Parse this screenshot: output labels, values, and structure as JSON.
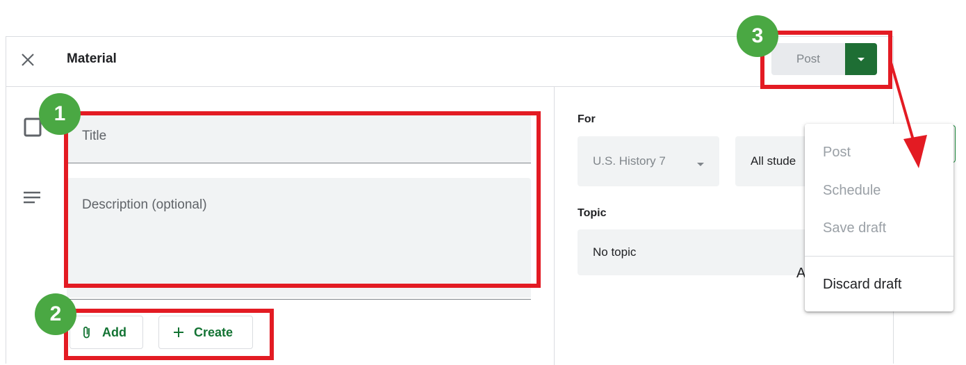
{
  "header": {
    "title": "Material"
  },
  "form": {
    "title_label": "Title",
    "description_label": "Description (optional)",
    "add_label": "Add",
    "create_label": "Create"
  },
  "side": {
    "for_label": "For",
    "class_value": "U.S. History 7",
    "students_value": "All stude",
    "topic_label": "Topic",
    "topic_value": "No topic",
    "clipped_char": "A"
  },
  "post_button": {
    "label": "Post"
  },
  "dropdown_menu": {
    "items": [
      "Post",
      "Schedule",
      "Save draft",
      "Discard draft"
    ]
  },
  "badges": [
    "1",
    "2",
    "3"
  ],
  "colors": {
    "accent": "#e31b23",
    "badge": "#4aa843",
    "brand_green": "#1e6e34",
    "link_green": "#137333"
  }
}
